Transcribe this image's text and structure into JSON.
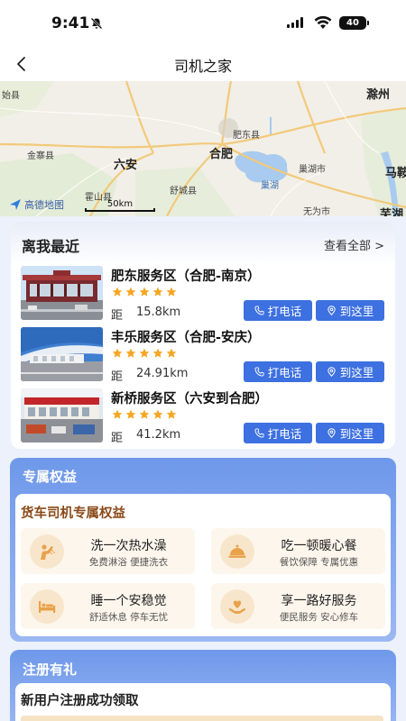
{
  "status": {
    "time": "9:41",
    "battery": "40"
  },
  "nav": {
    "title": "司机之家"
  },
  "map": {
    "labels": {
      "zuoshi": "始县",
      "chuzhou": "滁州",
      "feidong": "肥东县",
      "hefei": "合肥",
      "jinzhai": "金寨县",
      "luan": "六安",
      "chaohu_city": "巢湖市",
      "maan": "马鞍",
      "chaohu_lake": "巢湖",
      "shucheng": "舒城县",
      "huoshan": "霍山县",
      "wuwei": "无为市",
      "wuhu": "芜湖"
    },
    "logo": "高德地图",
    "scale": "50km"
  },
  "nearby": {
    "title": "离我最近",
    "view_all": "查看全部 >",
    "distance_label": "距",
    "call_label": "打电话",
    "nav_label": "到这里",
    "stations": [
      {
        "name": "肥东服务区（合肥-南京）",
        "rating": 5,
        "distance": "15.8km"
      },
      {
        "name": "丰乐服务区（合肥-安庆）",
        "rating": 5,
        "distance": "24.91km"
      },
      {
        "name": "新桥服务区（六安到合肥）",
        "rating": 5,
        "distance": "41.2km"
      }
    ]
  },
  "benefits": {
    "title": "专属权益",
    "subtitle": "货车司机专属权益",
    "items": [
      {
        "title": "洗一次热水澡",
        "desc": "免费淋浴  便捷洗衣",
        "icon": "shower-icon"
      },
      {
        "title": "吃一顿暖心餐",
        "desc": "餐饮保障  专属优惠",
        "icon": "dining-icon"
      },
      {
        "title": "睡一个安稳觉",
        "desc": "舒适休息  停车无忧",
        "icon": "bed-icon"
      },
      {
        "title": "享一路好服务",
        "desc": "便民服务  安心修车",
        "icon": "service-heart-icon"
      }
    ]
  },
  "register": {
    "title": "注册有礼",
    "subtitle": "新用户注册成功领取"
  },
  "colors": {
    "primary": "#3d70e0",
    "star": "#f5a623",
    "benefit_title": "#8a4a18"
  }
}
